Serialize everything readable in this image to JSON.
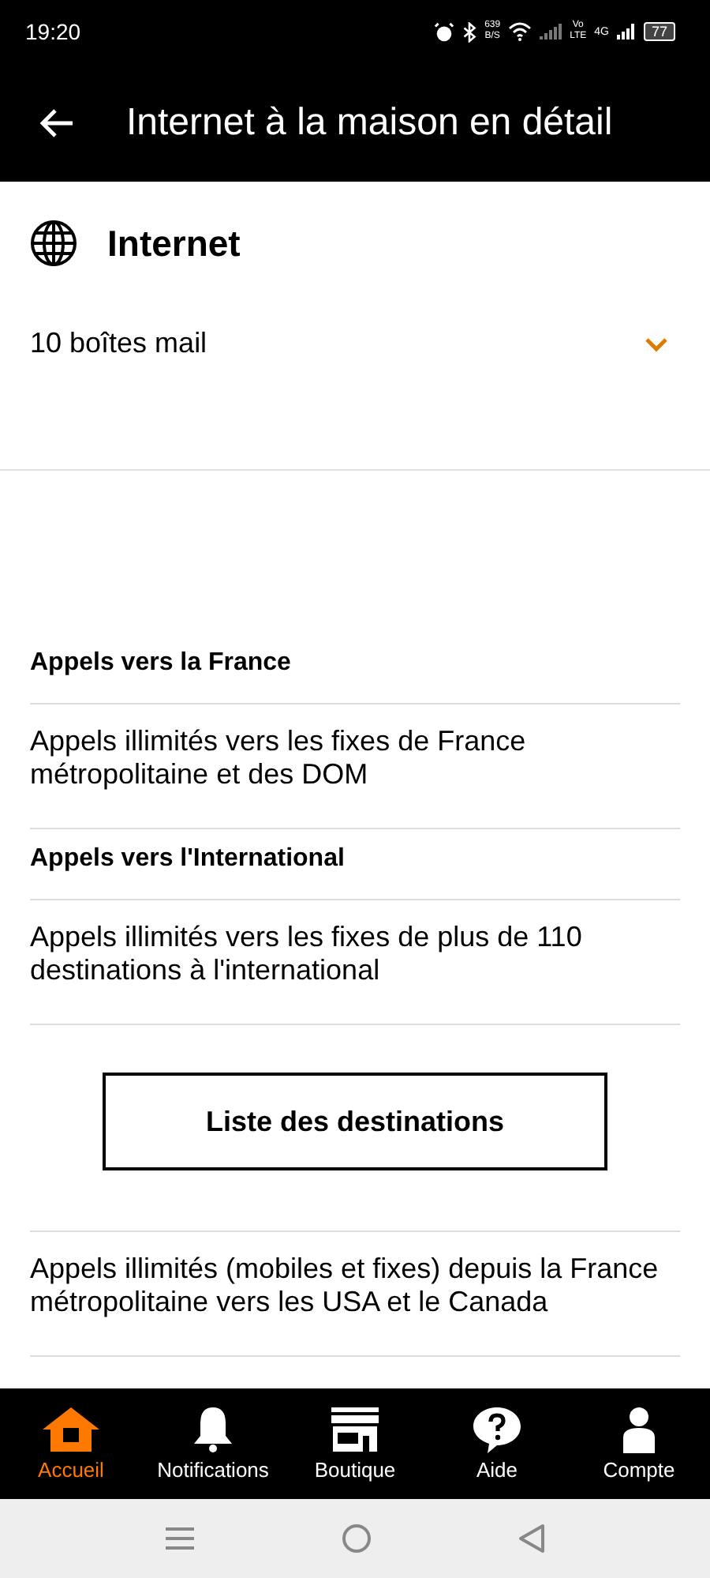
{
  "status_bar": {
    "time": "19:20",
    "speed_value": "639",
    "speed_unit": "B/S",
    "volte_top": "Vo",
    "volte_bottom": "LTE",
    "network": "4G",
    "battery": "77"
  },
  "header": {
    "title": "Internet à la maison en détail"
  },
  "section": {
    "title": "Internet",
    "detail": "10 boîtes mail",
    "expanded": false
  },
  "rows": [
    {
      "kind": "heading",
      "text": "Appels vers la France"
    },
    {
      "kind": "text",
      "text": "Appels illimités vers les fixes de France métropolitaine et des DOM"
    },
    {
      "kind": "heading",
      "text": "Appels vers l'International"
    },
    {
      "kind": "text",
      "text": "Appels illimités vers les fixes de plus de 110 destinations à l'international"
    },
    {
      "kind": "button",
      "text": "Liste des destinations"
    },
    {
      "kind": "text",
      "text": "Appels illimités (mobiles et fixes) depuis la France métropolitaine vers les USA et le Canada"
    }
  ],
  "nav": [
    {
      "label": "Accueil",
      "kind": "home",
      "selected": true
    },
    {
      "label": "Notifications",
      "kind": "bell",
      "selected": false
    },
    {
      "label": "Boutique",
      "kind": "shop",
      "selected": false
    },
    {
      "label": "Aide",
      "kind": "help",
      "selected": false
    },
    {
      "label": "Compte",
      "kind": "person",
      "selected": false
    }
  ]
}
